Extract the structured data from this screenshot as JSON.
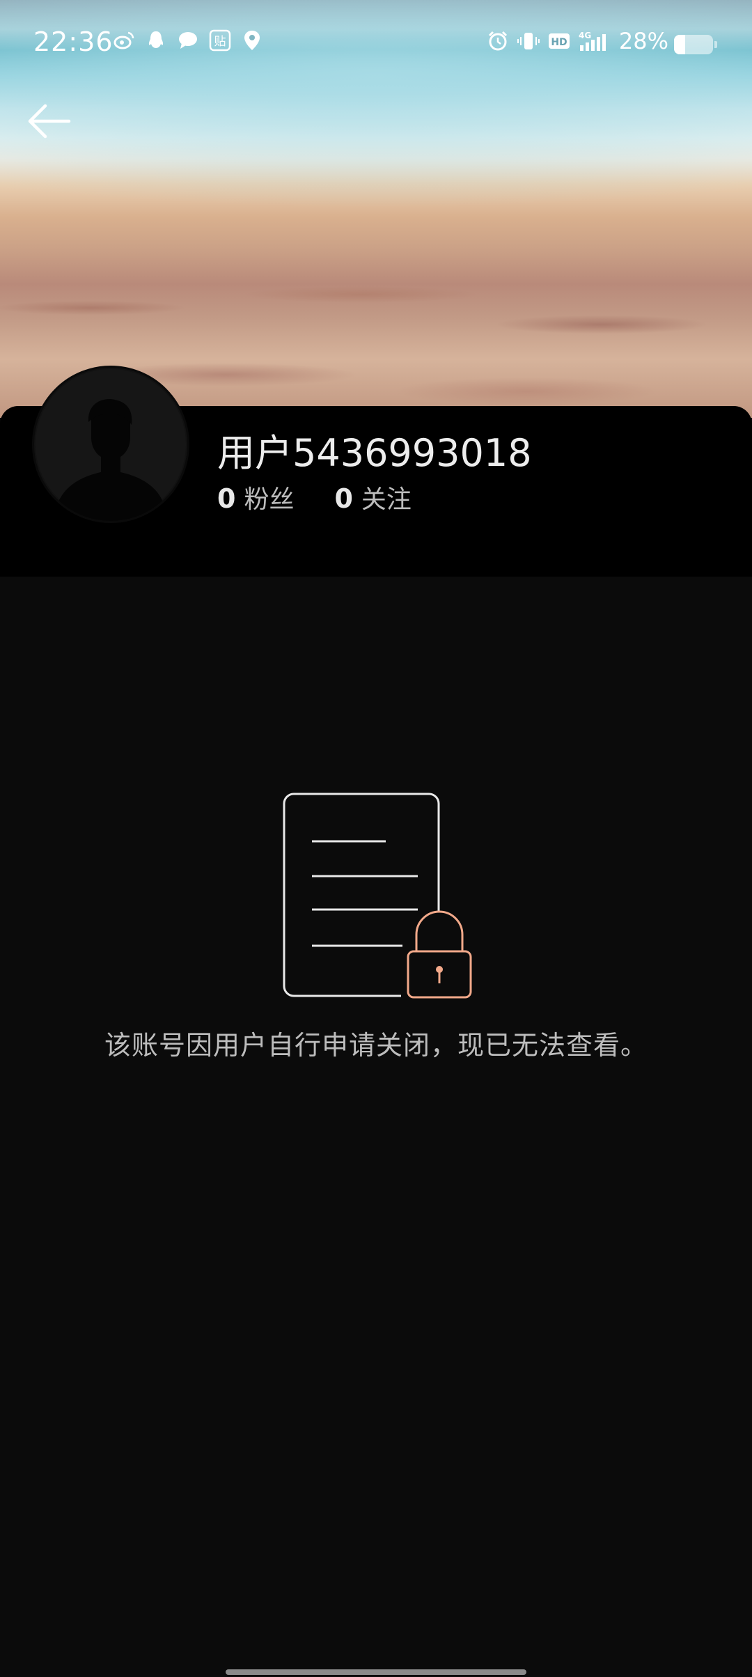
{
  "status_bar": {
    "time": "22:36",
    "battery_percent": "28%",
    "battery_level": 0.28,
    "left_icons": [
      "weibo-icon",
      "qq-icon",
      "message-icon",
      "tieba-icon",
      "location-icon"
    ],
    "right_icons": [
      "alarm-icon",
      "vibrate-icon",
      "hd-icon",
      "signal-4g-icon",
      "battery-icon"
    ],
    "network": "4G",
    "hd": "HD"
  },
  "header": {
    "back_icon": "back-arrow-icon"
  },
  "profile": {
    "username": "用户5436993018",
    "followers_count": "0",
    "followers_label": "粉丝",
    "following_count": "0",
    "following_label": "关注"
  },
  "empty_state": {
    "icon": "locked-document-icon",
    "message": "该账号因用户自行申请关闭，现已无法查看。"
  },
  "colors": {
    "background": "#0b0b0b",
    "panel": "#000000",
    "lock_accent": "#f2a98a",
    "text_primary": "#ededed",
    "text_secondary": "#bdbdbd"
  }
}
